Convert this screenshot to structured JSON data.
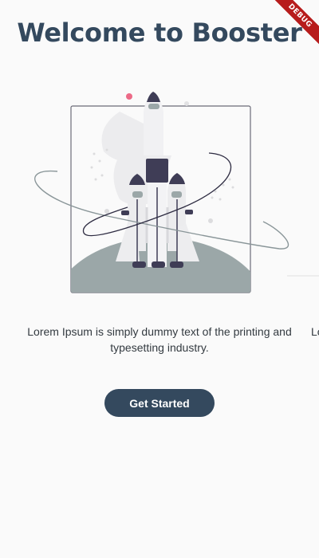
{
  "header": {
    "title": "Welcome to Booster"
  },
  "page": {
    "description": "Lorem Ipsum is simply dummy text of the printing and typesetting industry.",
    "next_page_peek": "Lo"
  },
  "actions": {
    "get_started_label": "Get Started"
  },
  "debug_banner": {
    "label": "DEBUG"
  },
  "illustration": {
    "name": "rocket-launch-illustration"
  },
  "colors": {
    "primary": "#34495e",
    "background": "#fafafa",
    "ground": "#9ba7a8",
    "rocket_dark": "#3f3d56",
    "accent_pink": "#ec6a87",
    "debug": "#b71c1c"
  }
}
